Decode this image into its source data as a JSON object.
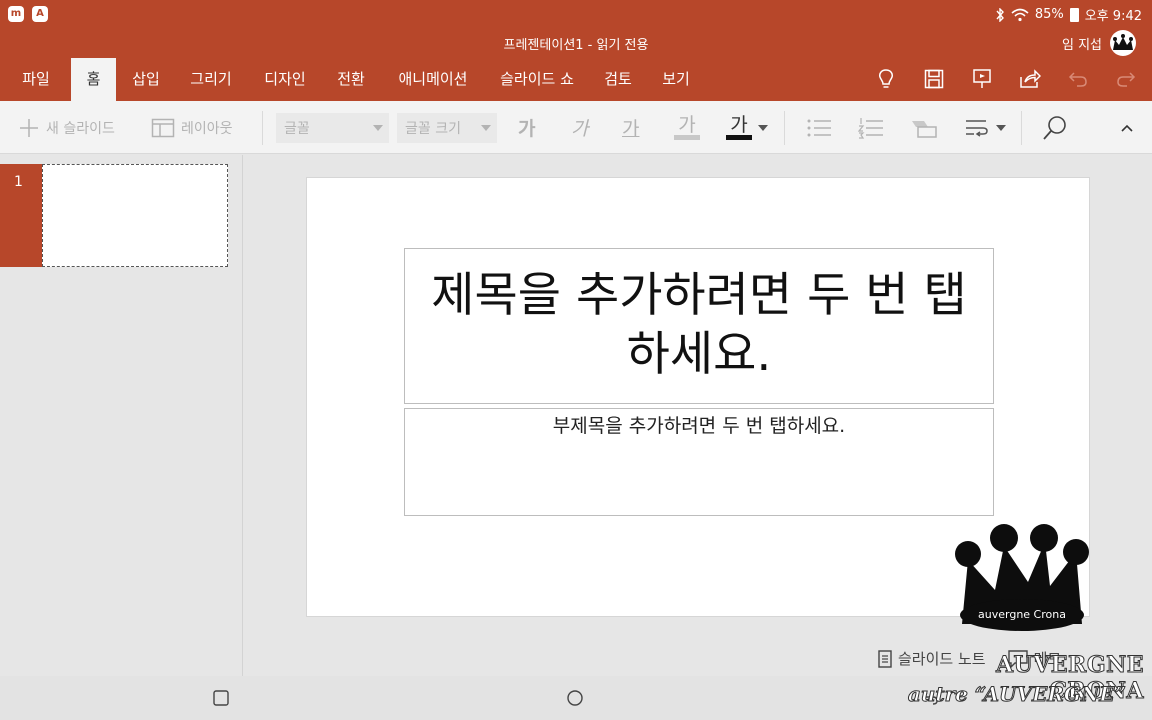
{
  "statusbar": {
    "left_icons": [
      "m",
      "A"
    ],
    "battery": "85%",
    "time": "오후 9:42"
  },
  "titlebar": {
    "doc_title": "프레젠테이션1 - 읽기 전용",
    "user_name": "임 지섭"
  },
  "tabs": [
    {
      "label": "파일"
    },
    {
      "label": "홈"
    },
    {
      "label": "삽입"
    },
    {
      "label": "그리기"
    },
    {
      "label": "디자인"
    },
    {
      "label": "전환"
    },
    {
      "label": "애니메이션"
    },
    {
      "label": "슬라이드 쇼"
    },
    {
      "label": "검토"
    },
    {
      "label": "보기"
    }
  ],
  "toolbar": {
    "new_slide": "새 슬라이드",
    "layout": "레이아웃",
    "font_placeholder": "글꼴",
    "font_size_placeholder": "글꼴 크기",
    "bold_glyph": "가",
    "italic_glyph": "가",
    "underline_glyph": "가",
    "highlight_glyph": "가",
    "font_color_glyph": "가"
  },
  "thumbnails": [
    {
      "number": "1"
    }
  ],
  "slide": {
    "title_placeholder": "제목을 추가하려면 두 번 탭하세요.",
    "subtitle_placeholder": "부제목을 추가하려면 두 번 탭하세요."
  },
  "notesbar": {
    "notes_label": "슬라이드 노트",
    "comments_label": "메모"
  },
  "watermark": {
    "crown_text": "auvergne Crona",
    "line1": "AUVERGNE CRONA",
    "line2": "autre “AUVERGNE”"
  }
}
